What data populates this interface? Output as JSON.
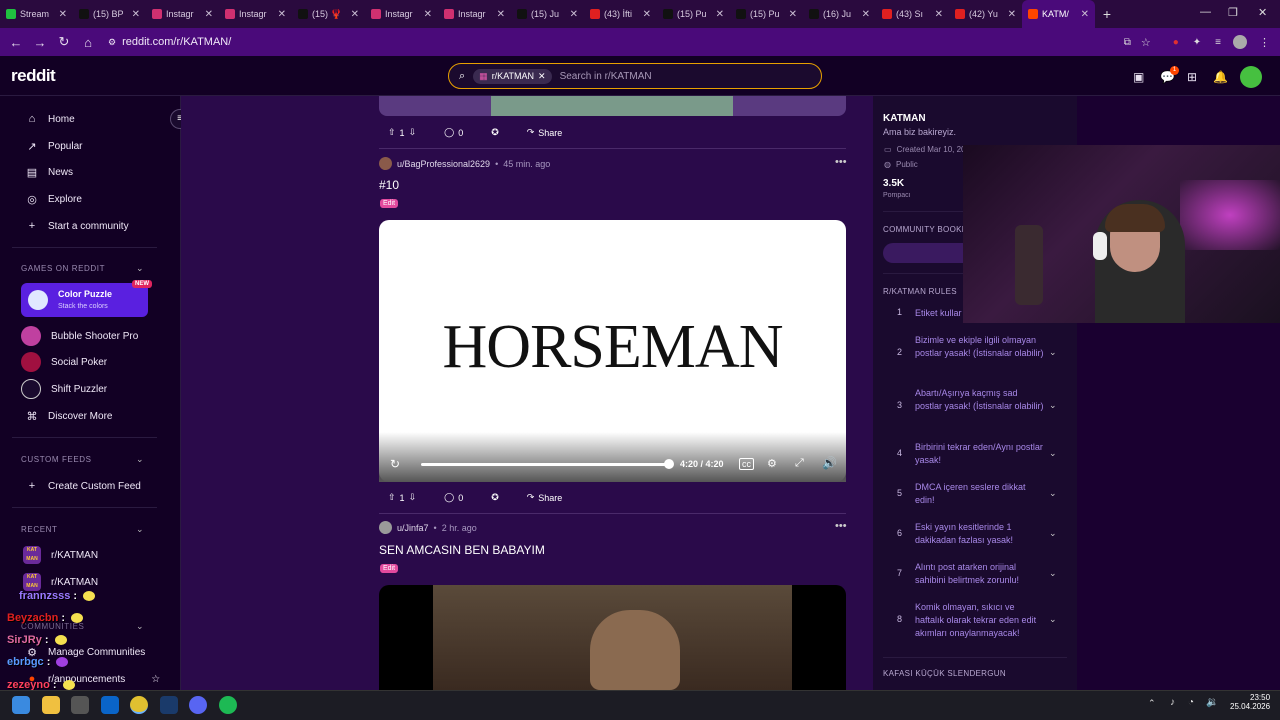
{
  "browser": {
    "tabs": [
      {
        "label": "Stream",
        "color": "#20c040"
      },
      {
        "label": "(15) BP",
        "color": "#111111"
      },
      {
        "label": "Instagr",
        "color": "#d03070"
      },
      {
        "label": "Instagr",
        "color": "#d03070"
      },
      {
        "label": "(15) 🦞",
        "color": "#111111"
      },
      {
        "label": "Instagr",
        "color": "#d03070"
      },
      {
        "label": "Instagr",
        "color": "#d03070"
      },
      {
        "label": "(15) Ju",
        "color": "#111111"
      },
      {
        "label": "(43) İfti",
        "color": "#e02020"
      },
      {
        "label": "(15) Pu",
        "color": "#111111"
      },
      {
        "label": "(15) Pu",
        "color": "#111111"
      },
      {
        "label": "(16) Ju",
        "color": "#111111"
      },
      {
        "label": "(43) Sı",
        "color": "#e02020"
      },
      {
        "label": "(42) Yu",
        "color": "#e02020"
      },
      {
        "label": "KATM/",
        "color": "#ff4500"
      }
    ],
    "new_tab": "+",
    "url": "reddit.com/r/KATMAN/"
  },
  "header": {
    "logo": "reddit",
    "search_chip": "r/KATMAN",
    "search_placeholder": "Search in r/KATMAN",
    "notif_count": "1"
  },
  "sidebar": {
    "nav": [
      {
        "label": "Home",
        "icon": "⌂"
      },
      {
        "label": "Popular",
        "icon": "↗"
      },
      {
        "label": "News",
        "icon": "▤"
      },
      {
        "label": "Explore",
        "icon": "◎"
      },
      {
        "label": "Start a community",
        "icon": "+"
      }
    ],
    "games_heading": "GAMES ON REDDIT",
    "featured_game": {
      "title": "Color Puzzle",
      "subtitle": "Stack the colors",
      "badge": "NEW"
    },
    "games": [
      {
        "label": "Bubble Shooter Pro",
        "color": "#c040a0"
      },
      {
        "label": "Social Poker",
        "color": "#a01040"
      },
      {
        "label": "Shift Puzzler",
        "color": "#eeeeee"
      },
      {
        "label": "Discover More",
        "color": "#888888"
      }
    ],
    "custom_heading": "CUSTOM FEEDS",
    "create_custom": "Create Custom Feed",
    "recent_heading": "RECENT",
    "recent": [
      "r/KATMAN",
      "r/KATMAN"
    ],
    "communities_heading": "COMMUNITIES",
    "manage": "Manage Communities",
    "announcements": "r/announcements"
  },
  "chat": [
    {
      "user": "frannzsss",
      "color": "#9a7aff"
    },
    {
      "user": "Beyzacbn",
      "color": "#e02020"
    },
    {
      "user": "SirJRy",
      "color": "#e06aa0"
    },
    {
      "user": "ebrbgc",
      "color": "#5a9aff"
    },
    {
      "user": "zezeyno",
      "color": "#ff4060"
    }
  ],
  "feed": {
    "post1": {
      "upvotes": "1",
      "comments": "0",
      "share": "Share"
    },
    "post2": {
      "author": "u/BagProfessional2629",
      "age": "45 min. ago",
      "title": "#10",
      "flair": "Edit",
      "video_text": "HORSEMAN",
      "video_time": "4:20 / 4:20",
      "progress": 1.0,
      "upvotes": "1",
      "comments": "0",
      "share": "Share"
    },
    "post3": {
      "author": "u/Jinfa7",
      "age": "2 hr. ago",
      "title": "SEN AMCASIN BEN BABAYIM",
      "flair": "Edit"
    }
  },
  "community": {
    "name": "KATMAN",
    "description": "Ama biz bakireyiz.",
    "created": "Created Mar 10, 20",
    "visibility": "Public",
    "members": "3.5K",
    "members_label": "Pompacı",
    "bookmarks_heading": "COMMUNITY BOOKM",
    "bookmark_btn": "Sı",
    "rules_heading": "R/KATMAN RULES",
    "rules": [
      {
        "num": "1",
        "text": "Etiket kullar"
      },
      {
        "num": "2",
        "text": "Bizimle ve ekiple ilgili olmayan postlar yasak! (İstisnalar olabilir)"
      },
      {
        "num": "3",
        "text": "Abartı/Aşırıya kaçmış sad postlar yasak! (İstisnalar olabilir)"
      },
      {
        "num": "4",
        "text": "Birbirini tekrar eden/Aynı postlar yasak!"
      },
      {
        "num": "5",
        "text": "DMCA içeren seslere dikkat edin!"
      },
      {
        "num": "6",
        "text": "Eski yayın kesitlerinde 1 dakikadan fazlası yasak!"
      },
      {
        "num": "7",
        "text": "Alıntı post atarken orijinal sahibini belirtmek zorunlu!"
      },
      {
        "num": "8",
        "text": "Komik olmayan, sıkıcı ve haftalık olarak tekrar eden edit akımları onaylanmayacak!"
      }
    ],
    "footer_heading": "KAFASI KÜÇÜK SLENDERGUN"
  },
  "taskbar": {
    "time": "23:50",
    "date": "25.04.2026"
  }
}
